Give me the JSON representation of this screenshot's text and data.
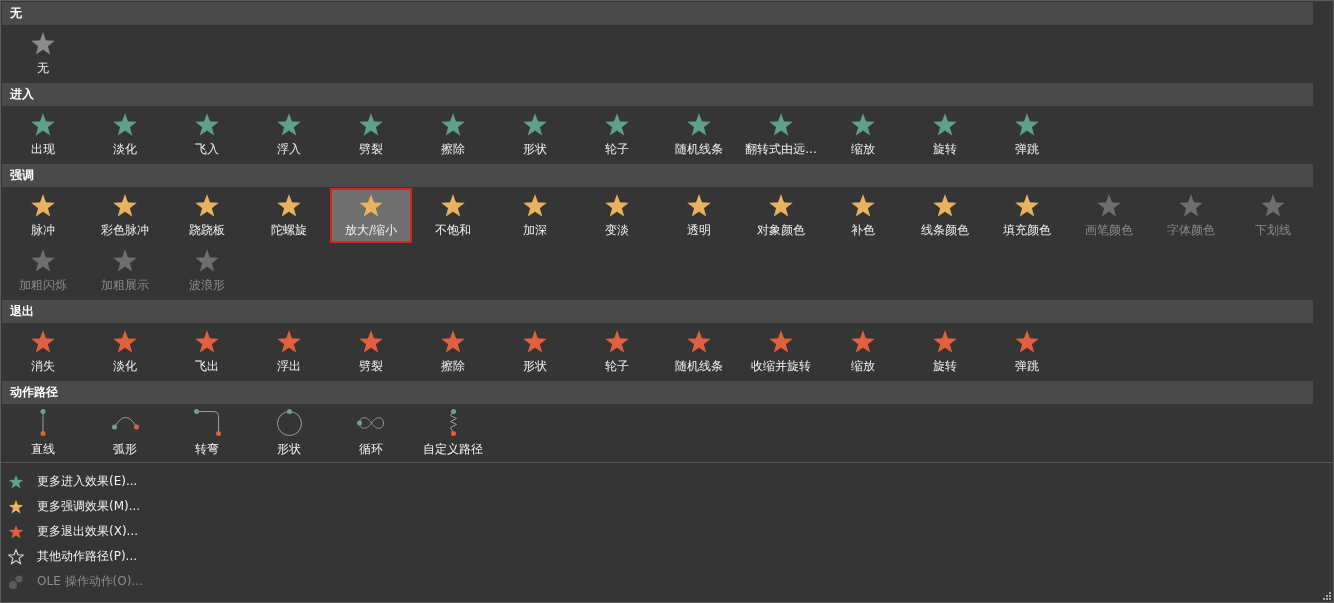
{
  "sections": [
    {
      "title": "无",
      "kind": "none",
      "items": [
        {
          "label": "无",
          "selected": false,
          "disabled": false
        }
      ]
    },
    {
      "title": "进入",
      "kind": "entrance",
      "items": [
        {
          "label": "出现",
          "selected": false,
          "disabled": false
        },
        {
          "label": "淡化",
          "selected": false,
          "disabled": false
        },
        {
          "label": "飞入",
          "selected": false,
          "disabled": false
        },
        {
          "label": "浮入",
          "selected": false,
          "disabled": false
        },
        {
          "label": "劈裂",
          "selected": false,
          "disabled": false
        },
        {
          "label": "擦除",
          "selected": false,
          "disabled": false
        },
        {
          "label": "形状",
          "selected": false,
          "disabled": false
        },
        {
          "label": "轮子",
          "selected": false,
          "disabled": false
        },
        {
          "label": "随机线条",
          "selected": false,
          "disabled": false
        },
        {
          "label": "翻转式由远...",
          "selected": false,
          "disabled": false
        },
        {
          "label": "缩放",
          "selected": false,
          "disabled": false
        },
        {
          "label": "旋转",
          "selected": false,
          "disabled": false
        },
        {
          "label": "弹跳",
          "selected": false,
          "disabled": false
        }
      ]
    },
    {
      "title": "强调",
      "kind": "emphasis",
      "items": [
        {
          "label": "脉冲",
          "selected": false,
          "disabled": false
        },
        {
          "label": "彩色脉冲",
          "selected": false,
          "disabled": false
        },
        {
          "label": "跷跷板",
          "selected": false,
          "disabled": false
        },
        {
          "label": "陀螺旋",
          "selected": false,
          "disabled": false
        },
        {
          "label": "放大/缩小",
          "selected": true,
          "disabled": false
        },
        {
          "label": "不饱和",
          "selected": false,
          "disabled": false
        },
        {
          "label": "加深",
          "selected": false,
          "disabled": false
        },
        {
          "label": "变淡",
          "selected": false,
          "disabled": false
        },
        {
          "label": "透明",
          "selected": false,
          "disabled": false
        },
        {
          "label": "对象颜色",
          "selected": false,
          "disabled": false
        },
        {
          "label": "补色",
          "selected": false,
          "disabled": false
        },
        {
          "label": "线条颜色",
          "selected": false,
          "disabled": false
        },
        {
          "label": "填充颜色",
          "selected": false,
          "disabled": false
        },
        {
          "label": "画笔颜色",
          "selected": false,
          "disabled": true
        },
        {
          "label": "字体颜色",
          "selected": false,
          "disabled": true
        },
        {
          "label": "下划线",
          "selected": false,
          "disabled": true
        },
        {
          "label": "加粗闪烁",
          "selected": false,
          "disabled": true
        },
        {
          "label": "加粗展示",
          "selected": false,
          "disabled": true
        },
        {
          "label": "波浪形",
          "selected": false,
          "disabled": true
        }
      ]
    },
    {
      "title": "退出",
      "kind": "exit",
      "items": [
        {
          "label": "消失",
          "selected": false,
          "disabled": false
        },
        {
          "label": "淡化",
          "selected": false,
          "disabled": false
        },
        {
          "label": "飞出",
          "selected": false,
          "disabled": false
        },
        {
          "label": "浮出",
          "selected": false,
          "disabled": false
        },
        {
          "label": "劈裂",
          "selected": false,
          "disabled": false
        },
        {
          "label": "擦除",
          "selected": false,
          "disabled": false
        },
        {
          "label": "形状",
          "selected": false,
          "disabled": false
        },
        {
          "label": "轮子",
          "selected": false,
          "disabled": false
        },
        {
          "label": "随机线条",
          "selected": false,
          "disabled": false
        },
        {
          "label": "收缩并旋转",
          "selected": false,
          "disabled": false
        },
        {
          "label": "缩放",
          "selected": false,
          "disabled": false
        },
        {
          "label": "旋转",
          "selected": false,
          "disabled": false
        },
        {
          "label": "弹跳",
          "selected": false,
          "disabled": false
        }
      ]
    },
    {
      "title": "动作路径",
      "kind": "path",
      "items": [
        {
          "label": "直线",
          "kind": "line",
          "selected": false,
          "disabled": false
        },
        {
          "label": "弧形",
          "kind": "arc",
          "selected": false,
          "disabled": false
        },
        {
          "label": "转弯",
          "kind": "turn",
          "selected": false,
          "disabled": false
        },
        {
          "label": "形状",
          "kind": "circle",
          "selected": false,
          "disabled": false
        },
        {
          "label": "循环",
          "kind": "loop",
          "selected": false,
          "disabled": false
        },
        {
          "label": "自定义路径",
          "kind": "custom",
          "selected": false,
          "disabled": false
        }
      ]
    }
  ],
  "menu": [
    {
      "label": "更多进入效果(E)...",
      "kind": "entrance",
      "disabled": false
    },
    {
      "label": "更多强调效果(M)...",
      "kind": "emphasis",
      "disabled": false
    },
    {
      "label": "更多退出效果(X)...",
      "kind": "exit",
      "disabled": false
    },
    {
      "label": "其他动作路径(P)...",
      "kind": "path",
      "disabled": false
    },
    {
      "label": "OLE 操作动作(O)...",
      "kind": "ole",
      "disabled": true
    }
  ]
}
